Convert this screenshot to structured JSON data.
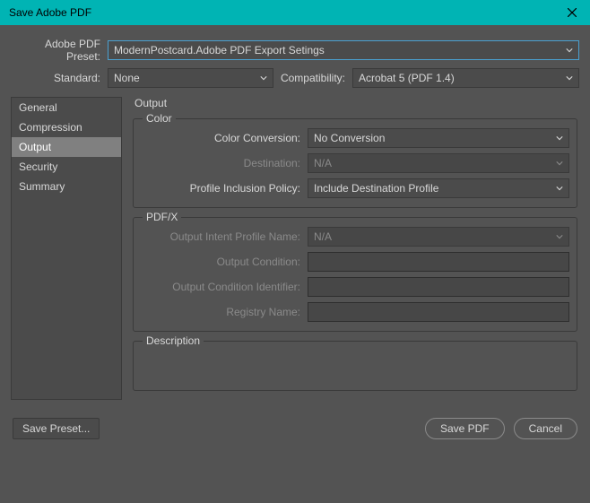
{
  "window": {
    "title": "Save Adobe PDF"
  },
  "preset": {
    "label": "Adobe PDF Preset:",
    "value": "ModernPostcard.Adobe PDF Export Setings"
  },
  "standard": {
    "label": "Standard:",
    "value": "None"
  },
  "compat": {
    "label": "Compatibility:",
    "value": "Acrobat 5 (PDF 1.4)"
  },
  "sidebar": {
    "items": [
      {
        "label": "General"
      },
      {
        "label": "Compression"
      },
      {
        "label": "Output"
      },
      {
        "label": "Security"
      },
      {
        "label": "Summary"
      }
    ]
  },
  "main": {
    "title": "Output",
    "color": {
      "legend": "Color",
      "conversion_label": "Color Conversion:",
      "conversion_value": "No Conversion",
      "destination_label": "Destination:",
      "destination_value": "N/A",
      "policy_label": "Profile Inclusion Policy:",
      "policy_value": "Include Destination Profile"
    },
    "pdfx": {
      "legend": "PDF/X",
      "intent_label": "Output Intent Profile Name:",
      "intent_value": "N/A",
      "condition_label": "Output Condition:",
      "identifier_label": "Output Condition Identifier:",
      "registry_label": "Registry Name:"
    },
    "description": {
      "legend": "Description"
    }
  },
  "footer": {
    "save_preset": "Save Preset...",
    "save_pdf": "Save PDF",
    "cancel": "Cancel"
  }
}
